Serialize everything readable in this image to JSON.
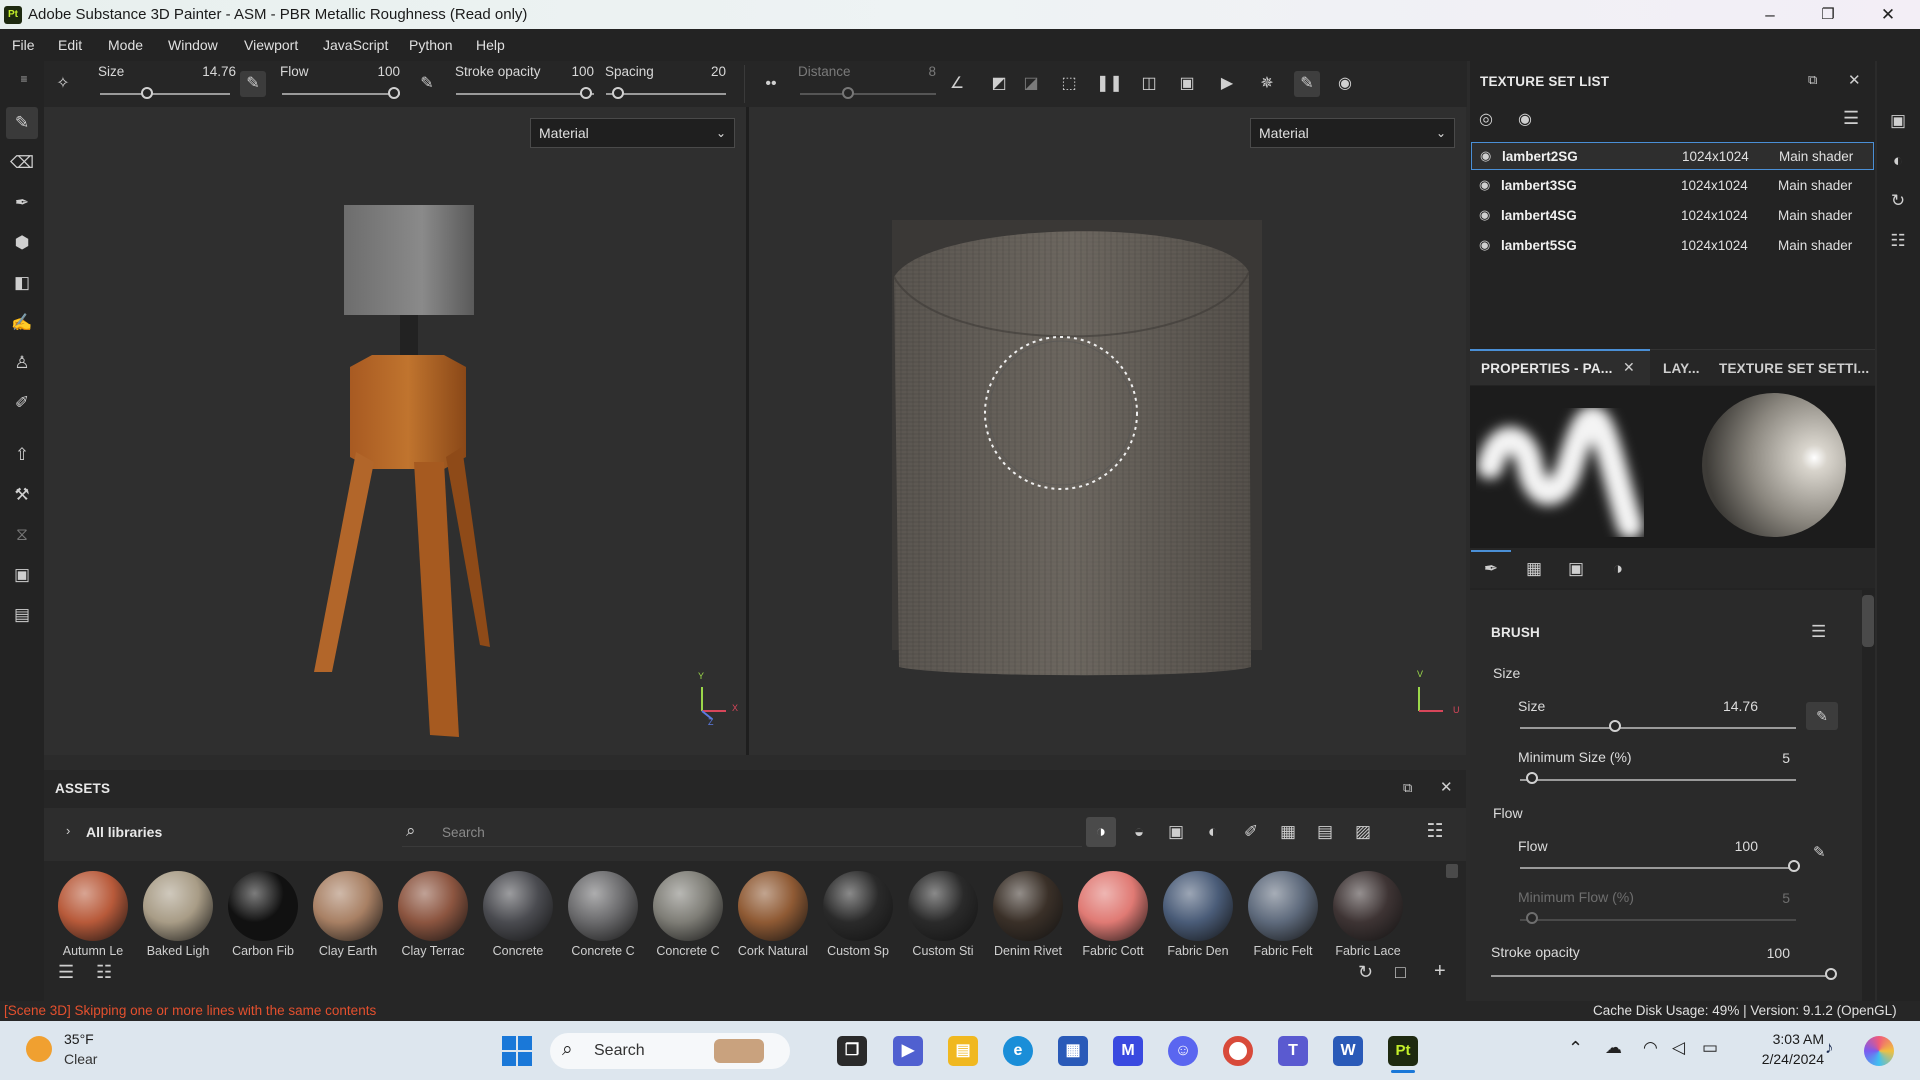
{
  "window": {
    "title": "Adobe Substance 3D Painter - ASM - PBR Metallic Roughness (Read only)",
    "app_icon": "Pt",
    "controls": [
      "minimize-icon",
      "restore-icon",
      "close-icon"
    ]
  },
  "menu": [
    "File",
    "Edit",
    "Mode",
    "Window",
    "Viewport",
    "JavaScript",
    "Python",
    "Help"
  ],
  "toolbar": {
    "size_label": "Size",
    "size_value": "14.76",
    "flow_label": "Flow",
    "flow_value": "100",
    "stroke_opacity_label": "Stroke opacity",
    "stroke_opacity_value": "100",
    "spacing_label": "Spacing",
    "spacing_value": "20",
    "distance_label": "Distance",
    "distance_value": "8"
  },
  "viewport3d": {
    "material_select": "Material",
    "axis_y": "Y",
    "axis_x": "X",
    "axis_z": "Z"
  },
  "viewport2d": {
    "material_select": "Material",
    "axis_v": "V",
    "axis_u": "U"
  },
  "texture_set_list": {
    "title": "TEXTURE SET LIST",
    "rows": [
      {
        "name": "lambert2SG",
        "res": "1024x1024",
        "shader": "Main shader",
        "selected": true
      },
      {
        "name": "lambert3SG",
        "res": "1024x1024",
        "shader": "Main shader",
        "selected": false
      },
      {
        "name": "lambert4SG",
        "res": "1024x1024",
        "shader": "Main shader",
        "selected": false
      },
      {
        "name": "lambert5SG",
        "res": "1024x1024",
        "shader": "Main shader",
        "selected": false
      }
    ]
  },
  "properties": {
    "tabs": [
      "PROPERTIES - PA...",
      "LAY...",
      "TEXTURE SET SETTI..."
    ],
    "section": "BRUSH",
    "size_group": "Size",
    "size_label": "Size",
    "size_value": "14.76",
    "size_fraction": 0.35,
    "min_size_label": "Minimum Size (%)",
    "min_size_value": "5",
    "min_size_fraction": 0.05,
    "flow_group": "Flow",
    "flow_label": "Flow",
    "flow_value": "100",
    "flow_fraction": 1.0,
    "min_flow_label": "Minimum Flow (%)",
    "min_flow_value": "5",
    "min_flow_fraction": 0.05,
    "stroke_opacity_label": "Stroke opacity",
    "stroke_opacity_value": "100",
    "stroke_opacity_fraction": 1.0
  },
  "assets": {
    "title": "ASSETS",
    "library": "All libraries",
    "search_placeholder": "Search",
    "items": [
      {
        "label": "Autumn Le",
        "color": "#b85a3a"
      },
      {
        "label": "Baked Ligh",
        "color": "#a89c86"
      },
      {
        "label": "Carbon Fib",
        "color": "#111111"
      },
      {
        "label": "Clay Earth",
        "color": "#a88064"
      },
      {
        "label": "Clay Terrac",
        "color": "#8c5540"
      },
      {
        "label": "Concrete",
        "color": "#4a4b50"
      },
      {
        "label": "Concrete C",
        "color": "#6a6a6c"
      },
      {
        "label": "Concrete C",
        "color": "#7e7d76"
      },
      {
        "label": "Cork Natural",
        "color": "#8f5a34"
      },
      {
        "label": "Custom Sp",
        "color": "#2a2a2a"
      },
      {
        "label": "Custom Sti",
        "color": "#2a2a2a"
      },
      {
        "label": "Denim Rivet",
        "color": "#3a3028"
      },
      {
        "label": "Fabric Cott",
        "color": "#e07a74"
      },
      {
        "label": "Fabric Den",
        "color": "#4a5c78"
      },
      {
        "label": "Fabric Felt",
        "color": "#5e6a7c"
      },
      {
        "label": "Fabric Lace",
        "color": "#3e3434"
      }
    ]
  },
  "status": {
    "message": "[Scene 3D] Skipping one or more lines with the same contents",
    "cache": "Cache Disk Usage:  49% | Version: 9.1.2 (OpenGL)"
  },
  "taskbar": {
    "temp": "35°F",
    "weather": "Clear",
    "search_placeholder": "Search",
    "time": "3:03 AM",
    "date": "2/24/2024"
  }
}
